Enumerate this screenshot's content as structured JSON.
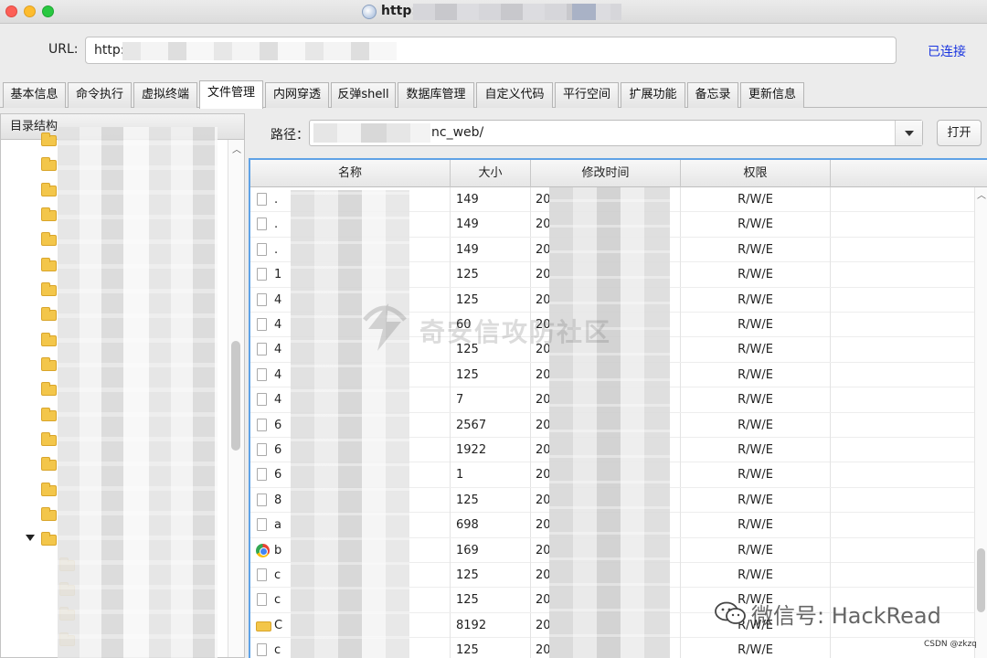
{
  "window": {
    "title": "http:"
  },
  "url_bar": {
    "label": "URL:",
    "value": "http:/"
  },
  "connection_status": "已连接",
  "tabs": [
    {
      "label": "基本信息",
      "active": false
    },
    {
      "label": "命令执行",
      "active": false
    },
    {
      "label": "虚拟终端",
      "active": false
    },
    {
      "label": "文件管理",
      "active": true
    },
    {
      "label": "内网穿透",
      "active": false
    },
    {
      "label": "反弹shell",
      "active": false
    },
    {
      "label": "数据库管理",
      "active": false
    },
    {
      "label": "自定义代码",
      "active": false
    },
    {
      "label": "平行空间",
      "active": false
    },
    {
      "label": "扩展功能",
      "active": false
    },
    {
      "label": "备忘录",
      "active": false
    },
    {
      "label": "更新信息",
      "active": false
    }
  ],
  "tree": {
    "header": "目录结构"
  },
  "path_bar": {
    "label": "路径：",
    "value": "nc_web/",
    "open_button": "打开"
  },
  "file_table": {
    "columns": [
      "名称",
      "大小",
      "修改时间",
      "权限"
    ],
    "rows": [
      {
        "icon": "file-icon",
        "name": ".",
        "size": "149",
        "time": "20",
        "perm": "R/W/E"
      },
      {
        "icon": "file-icon",
        "name": ".",
        "size": "149",
        "time": "20",
        "perm": "R/W/E"
      },
      {
        "icon": "file-icon",
        "name": ".",
        "size": "149",
        "time": "20",
        "perm": "R/W/E"
      },
      {
        "icon": "file-icon",
        "name": "1",
        "size": "125",
        "time": "20",
        "perm": "R/W/E"
      },
      {
        "icon": "file-icon",
        "name": "4",
        "size": "125",
        "time": "20",
        "perm": "R/W/E"
      },
      {
        "icon": "file-icon",
        "name": "4",
        "size": "60",
        "time": "20",
        "perm": "R/W/E"
      },
      {
        "icon": "file-icon",
        "name": "4",
        "size": "125",
        "time": "20",
        "perm": "R/W/E"
      },
      {
        "icon": "file-icon",
        "name": "4",
        "size": "125",
        "time": "20",
        "perm": "R/W/E"
      },
      {
        "icon": "file-icon",
        "name": "4",
        "size": "7",
        "time": "20",
        "perm": "R/W/E"
      },
      {
        "icon": "file-icon",
        "name": "6",
        "size": "2567",
        "time": "20",
        "perm": "R/W/E"
      },
      {
        "icon": "file-icon",
        "name": "6",
        "size": "1922",
        "time": "20",
        "perm": "R/W/E"
      },
      {
        "icon": "file-icon",
        "name": "6",
        "size": "1",
        "time": "20",
        "perm": "R/W/E"
      },
      {
        "icon": "file-icon",
        "name": "8",
        "size": "125",
        "time": "20",
        "perm": "R/W/E"
      },
      {
        "icon": "file-icon",
        "name": "a",
        "size": "698",
        "time": "20",
        "perm": "R/W/E"
      },
      {
        "icon": "chrome-icon",
        "name": "b",
        "size": "169",
        "time": "20",
        "perm": "R/W/E"
      },
      {
        "icon": "file-icon",
        "name": "c",
        "size": "125",
        "time": "20",
        "perm": "R/W/E"
      },
      {
        "icon": "file-icon",
        "name": "c",
        "size": "125",
        "time": "20",
        "perm": "R/W/E"
      },
      {
        "icon": "folder-icon",
        "name": "C",
        "size": "8192",
        "time": "20",
        "perm": "R/W/E"
      },
      {
        "icon": "file-icon",
        "name": "c",
        "size": "125",
        "time": "20",
        "perm": "R/W/E"
      }
    ]
  },
  "watermarks": {
    "center": "奇安信攻防社区",
    "wechat": "微信号: HackRead",
    "csdn": "CSDN @zkzq"
  }
}
